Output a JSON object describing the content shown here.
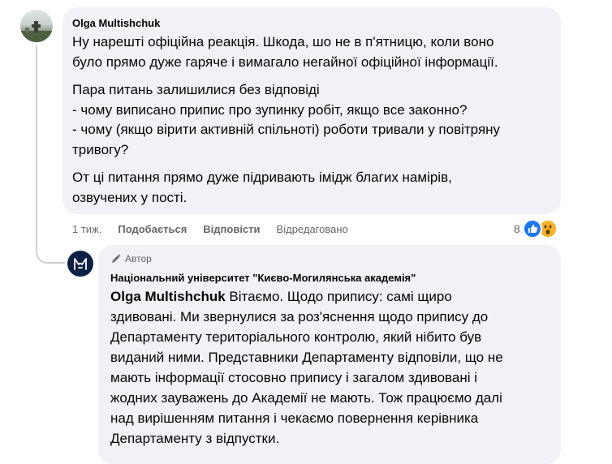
{
  "comment": {
    "author": "Olga Multishchuk",
    "paragraphs": [
      "Ну нарешті офіційна реакція. Шкода, шо не в п'ятницю, коли воно\nбуло прямо дуже гаряче і вимагало негайної офіційної інформації.",
      "Пара питань залишилися без відповіді\n- чому виписано припис про зупинку робіт, якщо все законно?\n- чому (якщо вірити активній спільноті) роботи тривали у повітряну\nтривогу?",
      "От ці питання прямо дуже підривають імідж благих намірів,\nозвучених у пості."
    ],
    "time": "1 тиж.",
    "like_label": "Подобається",
    "reply_label": "Відповісти",
    "edited_label": "Відредаговано",
    "reaction_count": "8"
  },
  "reply": {
    "badge": "Автор",
    "author": "Національний університет \"Києво-Могилянська академія\"",
    "tag": "Olga Multishchuk",
    "text": " Вітаємо. Щодо припису: самі щиро\nздивовані. Ми звернулися за роз'яснення щодо припису до\nДепартаменту територіального контролю, який нібито був\nвиданий ними. Представники Департаменту відповіли, що не\nмають інформації стосовно припису і загалом здивовані і\nжодних зауважень до Академії не мають. Тож працюємо далі\nнад вирішенням питання і чекаємо повернення керівника\nДепартаменту з відпустки."
  },
  "colors": {
    "bubble": "#f0f2f5",
    "meta": "#65676b",
    "like_blue": "#1877f2",
    "wow_yellow": "#f7b125",
    "university_navy": "#0d2147"
  },
  "icons": {
    "author_badge": "pencil-icon",
    "reactions": [
      "like-icon",
      "wow-icon"
    ]
  }
}
